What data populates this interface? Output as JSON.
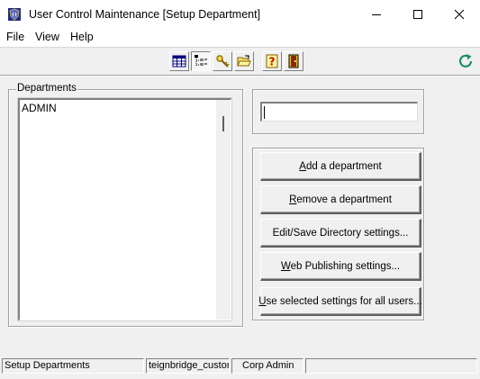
{
  "window": {
    "title": "User Control Maintenance [Setup Department]",
    "icon": "app-shield-icon"
  },
  "menu": {
    "items": [
      {
        "label": "File"
      },
      {
        "label": "View"
      },
      {
        "label": "Help"
      }
    ]
  },
  "toolbar": {
    "buttons": [
      {
        "icon": "grid-table-icon"
      },
      {
        "icon": "department-tree-icon",
        "pressed": true
      },
      {
        "icon": "keys-icon"
      },
      {
        "icon": "folder-open-icon"
      },
      {
        "icon": "question-help-icon"
      },
      {
        "icon": "exit-door-icon"
      }
    ],
    "refresh_icon": "refresh-icon"
  },
  "departments": {
    "label": "Departments",
    "items": [
      "ADMIN"
    ]
  },
  "department_name": {
    "value": ""
  },
  "actions": {
    "buttons": [
      {
        "label": "Add a department",
        "mnemonic": "A"
      },
      {
        "label": "Remove a department",
        "mnemonic": "R"
      },
      {
        "label": "Edit/Save Directory settings...",
        "mnemonic": ""
      },
      {
        "label": "Web Publishing settings...",
        "mnemonic": "W"
      },
      {
        "label": "Use selected settings for all users...",
        "mnemonic": "U"
      }
    ]
  },
  "status": {
    "panes": [
      "Setup Departments",
      "teignbridge_custom",
      "Corp Admin",
      "",
      ""
    ]
  },
  "colors": {
    "window_bg": "#f0f0f0",
    "refresh_accent": "#1b8f6a",
    "help_red": "#d40000"
  }
}
